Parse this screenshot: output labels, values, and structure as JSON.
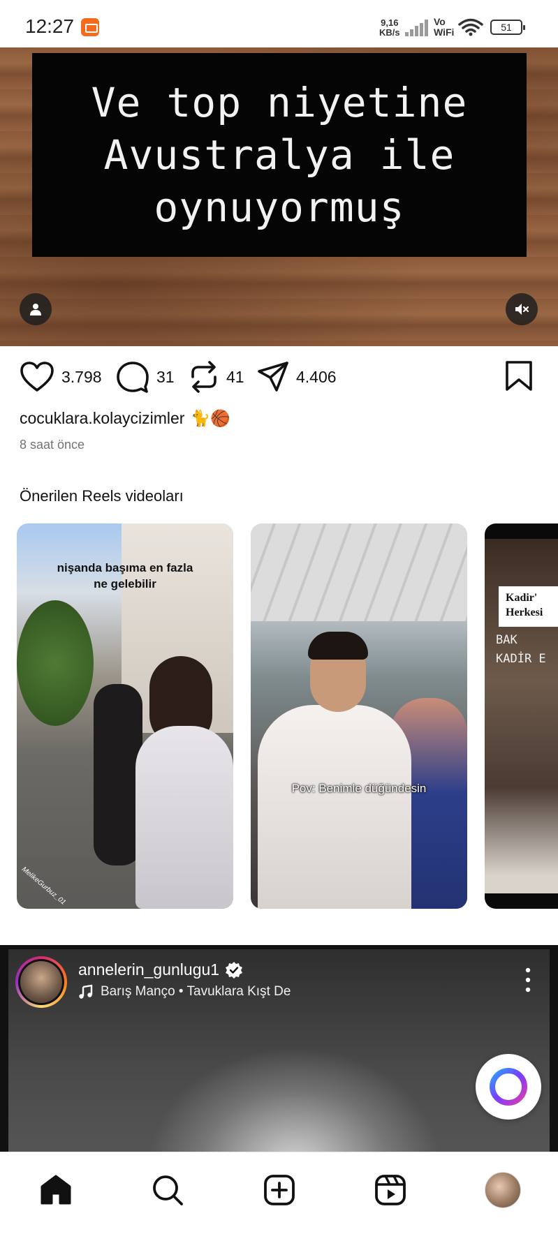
{
  "status_bar": {
    "time": "12:27",
    "net_speed_value": "9,16",
    "net_speed_unit": "KB/s",
    "vowifi_top": "Vo",
    "vowifi_bottom": "WiFi",
    "battery": "51"
  },
  "top_reel": {
    "caption": "Ve top niyetine\nAvustralya ile\noynuyormuş"
  },
  "actions": {
    "likes": "3.798",
    "comments": "31",
    "reposts": "41",
    "shares": "4.406"
  },
  "post": {
    "username": "cocuklara.kolaycizimler",
    "emoji": "🐈🏀",
    "time_ago": "8 saat önce"
  },
  "suggested": {
    "title": "Önerilen Reels videoları",
    "cards": [
      {
        "overlay_text": "nişanda başıma en fazla\nne gelebilir",
        "watermark": "MelikeGurbuz_01"
      },
      {
        "overlay_text": "Pov: Benimle düğündesin"
      },
      {
        "sign_text": "Kadir'\nHerkesi",
        "sub_text": "BAK\nKADİR E"
      }
    ]
  },
  "post2": {
    "username": "annelerin_gunlugu1",
    "verified": true,
    "music": "Barış Manço • Tavuklara Kışt De"
  },
  "colors": {
    "accent_text": "#111111",
    "secondary_text": "#737373",
    "ring_gradient": [
      "#d62976",
      "#fa7e1e",
      "#feda75",
      "#962fbf"
    ]
  },
  "icons": {
    "like": "heart-icon",
    "comment": "comment-icon",
    "repost": "repost-icon",
    "share": "send-icon",
    "save": "bookmark-icon",
    "nav": [
      "home-icon",
      "search-icon",
      "create-icon",
      "reels-icon",
      "profile-avatar"
    ]
  }
}
